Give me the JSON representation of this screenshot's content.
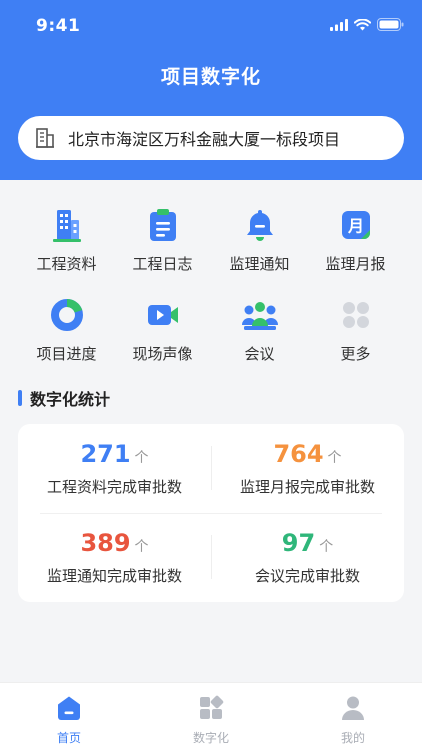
{
  "status_bar": {
    "time": "9:41"
  },
  "header": {
    "title": "项目数字化"
  },
  "project": {
    "name": "北京市海淀区万科金融大厦一标段项目",
    "icon": "building-icon"
  },
  "menu": [
    {
      "label": "工程资料",
      "icon": "building-icon"
    },
    {
      "label": "工程日志",
      "icon": "clipboard-icon"
    },
    {
      "label": "监理通知",
      "icon": "bell-icon"
    },
    {
      "label": "监理月报",
      "icon": "calendar-icon",
      "glyph": "月"
    },
    {
      "label": "项目进度",
      "icon": "progress-ring-icon"
    },
    {
      "label": "现场声像",
      "icon": "video-camera-icon"
    },
    {
      "label": "会议",
      "icon": "people-icon"
    },
    {
      "label": "更多",
      "icon": "more-grid-icon"
    }
  ],
  "stats_section": {
    "title": "数字化统计"
  },
  "stats": [
    {
      "value": "271",
      "unit": "个",
      "label": "工程资料完成审批数",
      "color": "#3f7ff4"
    },
    {
      "value": "764",
      "unit": "个",
      "label": "监理月报完成审批数",
      "color": "#f5923e"
    },
    {
      "value": "389",
      "unit": "个",
      "label": "监理通知完成审批数",
      "color": "#e8553e"
    },
    {
      "value": "97",
      "unit": "个",
      "label": "会议完成审批数",
      "color": "#2fb67a"
    }
  ],
  "tabs": [
    {
      "label": "首页",
      "icon": "home-icon",
      "active": true
    },
    {
      "label": "数字化",
      "icon": "grid-icon",
      "active": false
    },
    {
      "label": "我的",
      "icon": "user-icon",
      "active": false
    }
  ],
  "colors": {
    "primary": "#3f7ff4",
    "accent_green": "#35c06a",
    "inactive": "#b8bcc4"
  }
}
